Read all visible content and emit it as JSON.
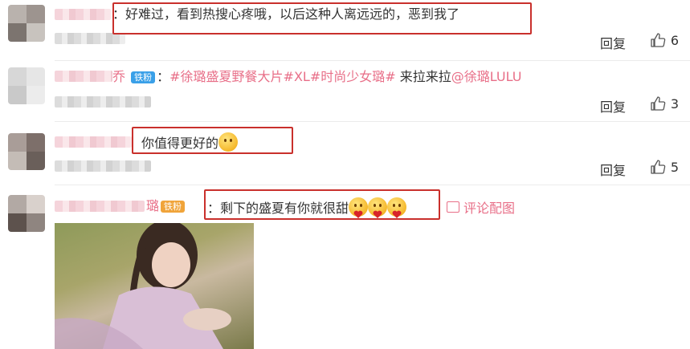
{
  "comments": [
    {
      "separator": "：",
      "text": "好难过，看到热搜心疼哦，以后这种人离远远的，恶到我了",
      "reply_label": "回复",
      "likes": "6"
    },
    {
      "name_suffix": "乔",
      "badge": "铁粉",
      "separator": "：",
      "topic1": "#徐璐盛夏野餐大片#",
      "topic_xl": "XL",
      "topic2": "#时尚少女璐#",
      "plain": "来拉来拉",
      "mention": "@徐璐LULU",
      "reply_label": "回复",
      "likes": "3"
    },
    {
      "text": "你值得更好的",
      "reply_label": "回复",
      "likes": "5"
    },
    {
      "name_suffix": "璐",
      "badge": "铁粉",
      "separator": "：",
      "text": "剩下的盛夏有你就很甜",
      "pic_link": "评论配图"
    }
  ],
  "icons": {
    "thumb": "thumbs-up-icon",
    "emoji": "shy-face-emoji",
    "heart_emoji": "face-with-heart-emoji",
    "picture": "image-icon"
  },
  "colors": {
    "highlight_box": "#c9302c",
    "topic": "#e86f88",
    "badge": "#3aa0e8"
  }
}
